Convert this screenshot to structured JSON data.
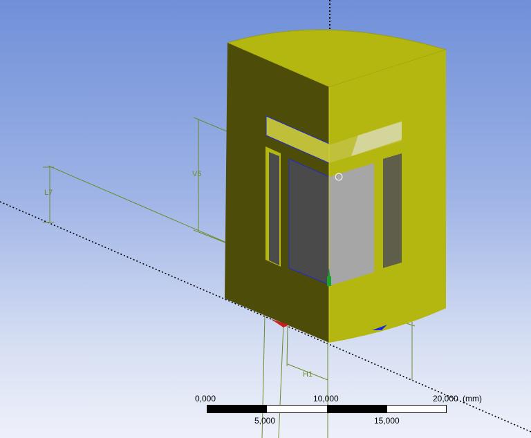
{
  "viewport": {
    "background_top": "#6f8fd8",
    "background_bottom": "#eef1fa"
  },
  "model": {
    "face_color": "#b4b70f",
    "side_color": "#4d4c08",
    "glass_color": "#9a9a9a",
    "edge_highlight": "#1f2bd6"
  },
  "dimensions": {
    "v5": "V5",
    "l7": "L7",
    "h1": "H1"
  },
  "scale_bar": {
    "top_labels": [
      "0,000",
      "10,000",
      "20,000"
    ],
    "unit": "(mm)",
    "bottom_labels": [
      "5,000",
      "15,000"
    ]
  },
  "triad": {
    "x_color": "#c81e1e",
    "y_color": "#1aa32b",
    "z_color": "#1c2bd8"
  }
}
